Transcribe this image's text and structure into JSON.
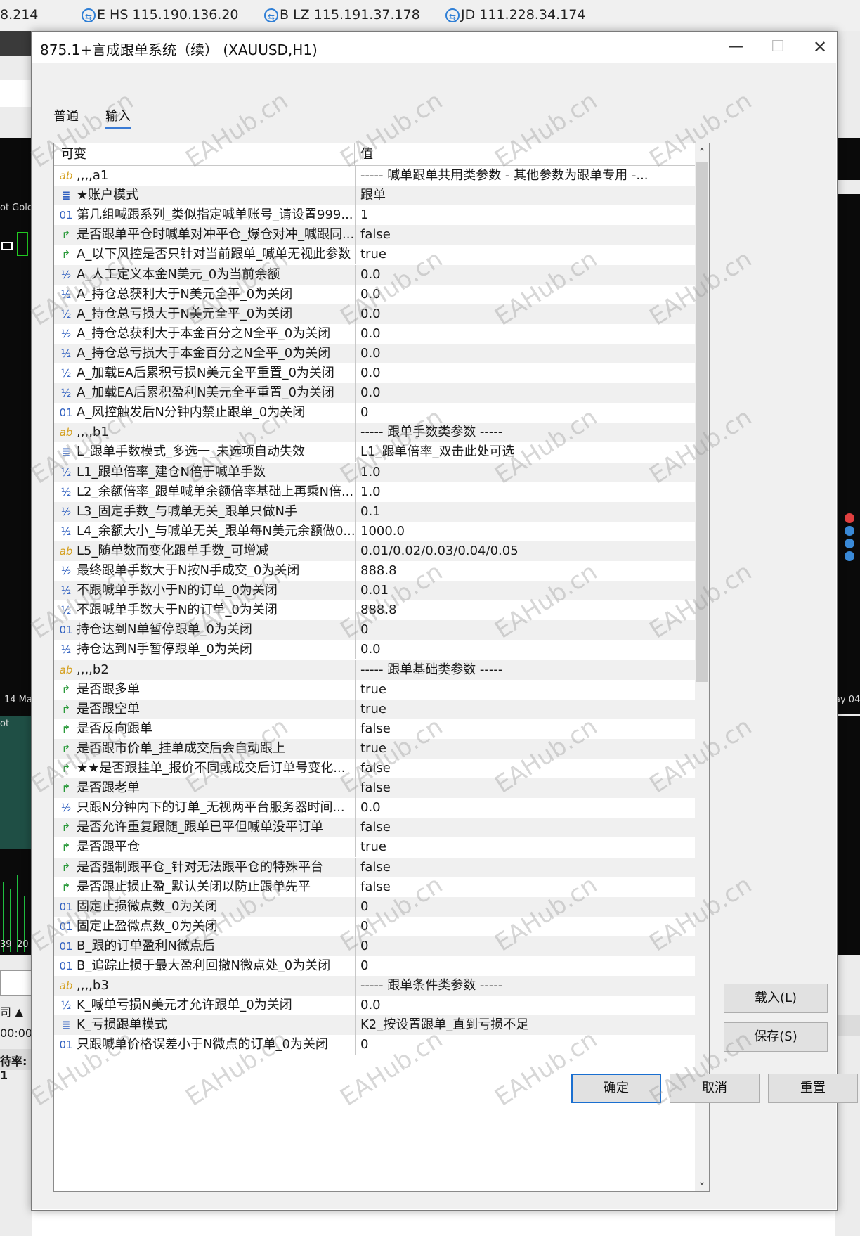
{
  "servers": [
    {
      "label": "8.214"
    },
    {
      "label": "E HS 115.190.136.20"
    },
    {
      "label": "B LZ 115.191.37.178"
    },
    {
      "label": "JD 111.228.34.174"
    }
  ],
  "background": {
    "chart_labels": [
      "ot Gold",
      "14 Ma",
      "ot",
      "39",
      "20",
      "ay 04"
    ],
    "terminal_labels": [
      "司 ▲",
      "00:00",
      "待率: 1"
    ]
  },
  "dialog": {
    "title": "875.1+言成跟单系统（续） (XAUUSD,H1)",
    "controls": {
      "minimize": "—",
      "maximize": "☐",
      "close": "✕"
    },
    "tabs": [
      {
        "label": "普通"
      },
      {
        "label": "输入"
      }
    ],
    "table": {
      "col_variable": "可变",
      "col_value": "值",
      "rows": [
        {
          "icon": "ab",
          "name": ",,,,a1",
          "value": "----- 喊单跟单共用类参数 - 其他参数为跟单专用 -..."
        },
        {
          "icon": "enum",
          "name": "★账户模式",
          "value": "跟单"
        },
        {
          "icon": "01",
          "name": "第几组喊跟系列_类似指定喊单账号_请设置999...",
          "value": "1"
        },
        {
          "icon": "bool",
          "name": "是否跟单平仓时喊单对冲平仓_爆仓对冲_喊跟同...",
          "value": "false"
        },
        {
          "icon": "bool",
          "name": "A_以下风控是否只针对当前跟单_喊单无视此参数",
          "value": "true"
        },
        {
          "icon": "½",
          "name": "A_人工定义本金N美元_0为当前余额",
          "value": "0.0"
        },
        {
          "icon": "½",
          "name": "A_持仓总获利大于N美元全平_0为关闭",
          "value": "0.0"
        },
        {
          "icon": "½",
          "name": "A_持仓总亏损大于N美元全平_0为关闭",
          "value": "0.0"
        },
        {
          "icon": "½",
          "name": "A_持仓总获利大于本金百分之N全平_0为关闭",
          "value": "0.0"
        },
        {
          "icon": "½",
          "name": "A_持仓总亏损大于本金百分之N全平_0为关闭",
          "value": "0.0"
        },
        {
          "icon": "½",
          "name": "A_加载EA后累积亏损N美元全平重置_0为关闭",
          "value": "0.0"
        },
        {
          "icon": "½",
          "name": "A_加载EA后累积盈利N美元全平重置_0为关闭",
          "value": "0.0"
        },
        {
          "icon": "01",
          "name": "A_风控触发后N分钟内禁止跟单_0为关闭",
          "value": "0"
        },
        {
          "icon": "ab",
          "name": ",,,,b1",
          "value": "----- 跟单手数类参数 -----"
        },
        {
          "icon": "enum",
          "name": "L_跟单手数模式_多选一_未选项自动失效",
          "value": "L1_跟单倍率_双击此处可选"
        },
        {
          "icon": "½",
          "name": "L1_跟单倍率_建仓N倍于喊单手数",
          "value": "1.0"
        },
        {
          "icon": "½",
          "name": "L2_余额倍率_跟单喊单余额倍率基础上再乘N倍...",
          "value": "1.0"
        },
        {
          "icon": "½",
          "name": "L3_固定手数_与喊单无关_跟单只做N手",
          "value": "0.1"
        },
        {
          "icon": "½",
          "name": "L4_余额大小_与喊单无关_跟单每N美元余额做0....",
          "value": "1000.0"
        },
        {
          "icon": "ab",
          "name": "L5_随单数而变化跟单手数_可增减",
          "value": "0.01/0.02/0.03/0.04/0.05"
        },
        {
          "icon": "½",
          "name": "最终跟单手数大于N按N手成交_0为关闭",
          "value": "888.8"
        },
        {
          "icon": "½",
          "name": "不跟喊单手数小于N的订单_0为关闭",
          "value": "0.01"
        },
        {
          "icon": "½",
          "name": "不跟喊单手数大于N的订单_0为关闭",
          "value": "888.8"
        },
        {
          "icon": "01",
          "name": "持仓达到N单暂停跟单_0为关闭",
          "value": "0"
        },
        {
          "icon": "½",
          "name": "持仓达到N手暂停跟单_0为关闭",
          "value": "0.0"
        },
        {
          "icon": "ab",
          "name": ",,,,b2",
          "value": "----- 跟单基础类参数 -----"
        },
        {
          "icon": "bool",
          "name": "是否跟多单",
          "value": "true"
        },
        {
          "icon": "bool",
          "name": "是否跟空单",
          "value": "true"
        },
        {
          "icon": "bool",
          "name": "是否反向跟单",
          "value": "false"
        },
        {
          "icon": "bool",
          "name": "是否跟市价单_挂单成交后会自动跟上",
          "value": "true"
        },
        {
          "icon": "bool",
          "name": "★★是否跟挂单_报价不同或成交后订单号变化...",
          "value": "false"
        },
        {
          "icon": "bool",
          "name": "是否跟老单",
          "value": "false"
        },
        {
          "icon": "½",
          "name": "只跟N分钟内下的订单_无视两平台服务器时间...",
          "value": "0.0"
        },
        {
          "icon": "bool",
          "name": "是否允许重复跟随_跟单已平但喊单没平订单",
          "value": "false"
        },
        {
          "icon": "bool",
          "name": "是否跟平仓",
          "value": "true"
        },
        {
          "icon": "bool",
          "name": "是否强制跟平仓_针对无法跟平仓的特殊平台",
          "value": "false"
        },
        {
          "icon": "bool",
          "name": "是否跟止损止盈_默认关闭以防止跟单先平",
          "value": "false"
        },
        {
          "icon": "01",
          "name": "固定止损微点数_0为关闭",
          "value": "0"
        },
        {
          "icon": "01",
          "name": "固定止盈微点数_0为关闭",
          "value": "0"
        },
        {
          "icon": "01",
          "name": "B_跟的订单盈利N微点后",
          "value": "0"
        },
        {
          "icon": "01",
          "name": "B_追踪止损于最大盈利回撤N微点处_0为关闭",
          "value": "0"
        },
        {
          "icon": "ab",
          "name": ",,,,b3",
          "value": "----- 跟单条件类参数 -----"
        },
        {
          "icon": "½",
          "name": "K_喊单亏损N美元才允许跟单_0为关闭",
          "value": "0.0"
        },
        {
          "icon": "enum",
          "name": "K_亏损跟单模式",
          "value": "K2_按设置跟单_直到亏损不足"
        },
        {
          "icon": "01",
          "name": "只跟喊单价格误差小于N微点的订单_0为关闭",
          "value": "0"
        }
      ]
    },
    "buttons": {
      "load": "载入(L)",
      "save": "保存(S)",
      "ok": "确定",
      "cancel": "取消",
      "reset": "重置"
    },
    "scroll": {
      "up": "⌃",
      "down": "⌄"
    },
    "watermark": "EAHub.cn"
  }
}
